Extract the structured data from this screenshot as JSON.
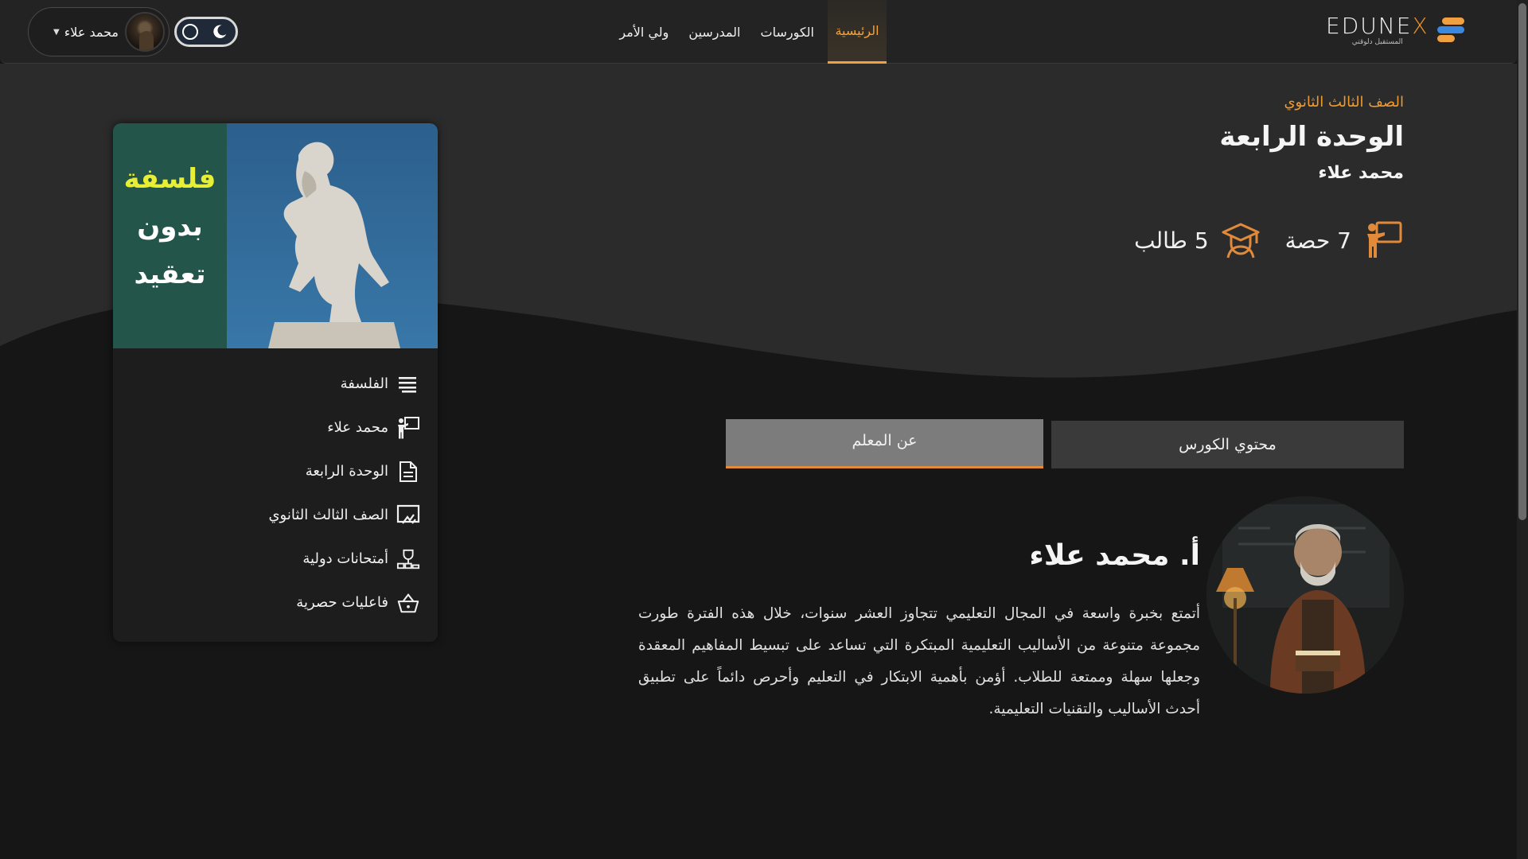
{
  "header": {
    "logo": {
      "word_prefix": "EDUNE",
      "word_x": "X",
      "tagline": "المستقبل دلوقتي",
      "mark_colors": [
        "#f0a040",
        "#3a88e0",
        "#f0a040"
      ]
    },
    "nav": [
      {
        "label": "الرئيسية",
        "active": true
      },
      {
        "label": "الكورسات",
        "active": false
      },
      {
        "label": "المدرسين",
        "active": false
      },
      {
        "label": "ولي الأمر",
        "active": false
      }
    ],
    "user": {
      "name": "محمد علاء"
    },
    "theme_toggle": {
      "mode": "dark"
    }
  },
  "hero": {
    "grade": "الصف الثالث الثانوي",
    "unit_title": "الوحدة الرابعة",
    "teacher": "محمد علاء",
    "stats": {
      "lessons": "7 حصة",
      "students": "5 طالب"
    }
  },
  "card": {
    "cover": {
      "line1": "فلسفة",
      "line2": "بدون",
      "line3": "تعقيد"
    },
    "items": [
      {
        "icon": "list-icon",
        "label": "الفلسفة"
      },
      {
        "icon": "teacher-icon",
        "label": "محمد علاء"
      },
      {
        "icon": "document-icon",
        "label": "الوحدة الرابعة"
      },
      {
        "icon": "classroom-icon",
        "label": "الصف الثالث الثانوي"
      },
      {
        "icon": "trophy-icon",
        "label": "أمتحانات دولية"
      },
      {
        "icon": "basket-icon",
        "label": "فاعليات حصرية"
      }
    ]
  },
  "tabs": {
    "content": "محتوي الكورس",
    "teacher": "عن المعلم",
    "active": "teacher"
  },
  "teacher_section": {
    "heading": "أ. محمد علاء",
    "bio": "أتمتع بخبرة واسعة في المجال التعليمي تتجاوز العشر سنوات، خلال هذه الفترة طورت مجموعة متنوعة من الأساليب التعليمية المبتكرة التي تساعد على تبسيط المفاهيم المعقدة وجعلها سهلة وممتعة للطلاب. أؤمن بأهمية الابتكار في التعليم وأحرص دائماً على تطبيق أحدث الأساليب والتقنيات التعليمية."
  },
  "colors": {
    "accent": "#f09a2c",
    "header_bg": "#232323",
    "hero_bg": "#2b2b2b",
    "page_bg": "#161616"
  }
}
